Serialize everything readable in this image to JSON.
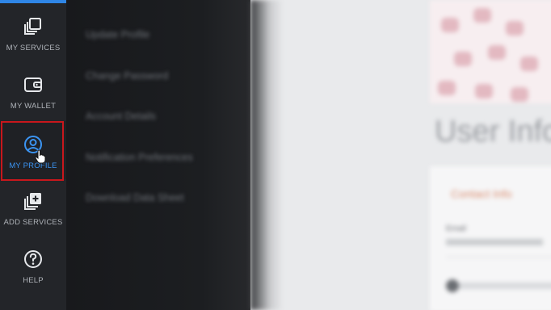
{
  "sidebar": {
    "items": [
      {
        "id": "my-services",
        "label": "MY SERVICES",
        "icon": "stacked-squares-icon"
      },
      {
        "id": "my-wallet",
        "label": "MY WALLET",
        "icon": "wallet-icon"
      },
      {
        "id": "my-profile",
        "label": "MY PROFILE",
        "icon": "user-circle-icon",
        "active": true
      },
      {
        "id": "add-services",
        "label": "ADD SERVICES",
        "icon": "add-stack-icon"
      },
      {
        "id": "help",
        "label": "HELP",
        "icon": "help-circle-icon"
      }
    ]
  },
  "submenu": {
    "items": [
      "Update Profile",
      "Change Password",
      "Account Details",
      "Notification Preferences",
      "Download Data Sheet"
    ]
  },
  "main": {
    "title": "User Info",
    "card_heading": "Contact Info",
    "field_label": "Email"
  },
  "colors": {
    "accent": "#3b94f2",
    "highlight_border": "#c8171c",
    "rail_bg": "#232529"
  }
}
